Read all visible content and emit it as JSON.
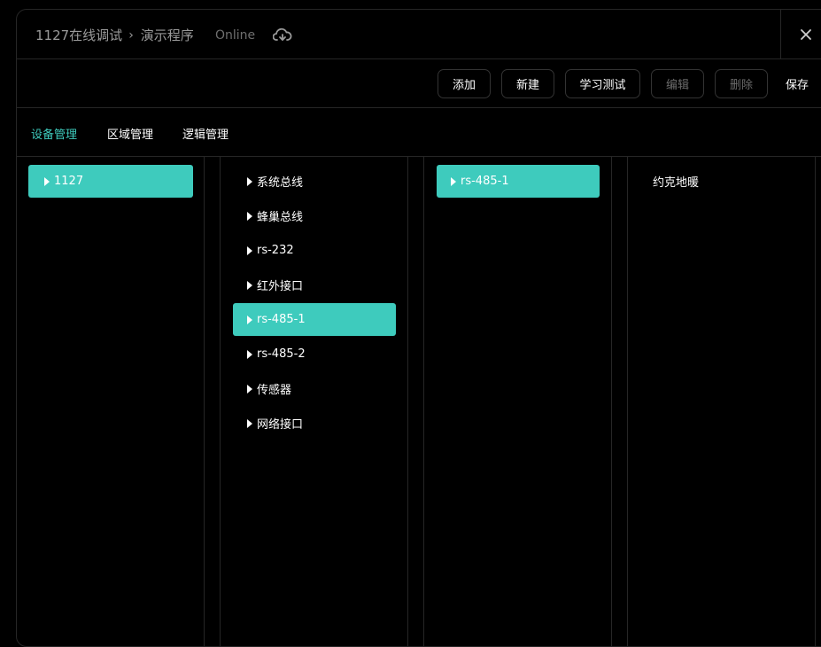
{
  "header": {
    "breadcrumb_root": "1127在线调试",
    "breadcrumb_current": "演示程序",
    "status": "Online",
    "cloud_icon": "cloud-sync-icon",
    "close_icon": "close-icon"
  },
  "toolbar": {
    "add_label": "添加",
    "new_label": "新建",
    "learn_label": "学习测试",
    "edit_label": "编辑",
    "delete_label": "删除",
    "save_label": "保存"
  },
  "tabs": [
    {
      "label": "设备管理",
      "active": true
    },
    {
      "label": "区域管理",
      "active": false
    },
    {
      "label": "逻辑管理",
      "active": false
    }
  ],
  "columns": {
    "hosts": [
      {
        "label": "1127",
        "selected": true
      }
    ],
    "buses": [
      {
        "label": "系统总线",
        "selected": false
      },
      {
        "label": "蜂巢总线",
        "selected": false
      },
      {
        "label": "rs-232",
        "selected": false
      },
      {
        "label": "红外接口",
        "selected": false
      },
      {
        "label": "rs-485-1",
        "selected": true
      },
      {
        "label": "rs-485-2",
        "selected": false
      },
      {
        "label": "传感器",
        "selected": false
      },
      {
        "label": "网络接口",
        "selected": false
      }
    ],
    "ports": [
      {
        "label": "rs-485-1",
        "selected": true
      }
    ],
    "devices": [
      {
        "label": "约克地暖"
      }
    ]
  },
  "colors": {
    "accent": "#3ecbbd",
    "background": "#000000",
    "border": "#262626"
  }
}
